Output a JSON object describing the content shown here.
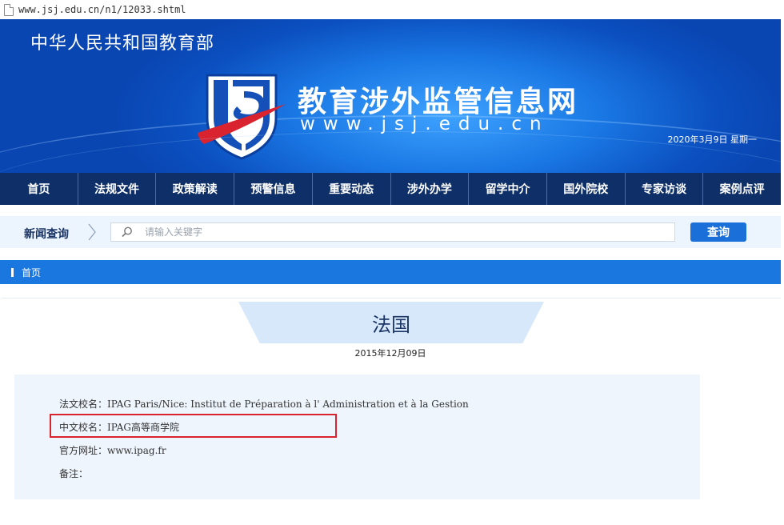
{
  "browser": {
    "url": "www.jsj.edu.cn/n1/12033.shtml"
  },
  "header": {
    "ministry": "中华人民共和国教育部",
    "site_title": "教育涉外监管信息网",
    "site_url": "www.jsj.edu.cn",
    "date": "2020年3月9日  星期一",
    "colors": {
      "banner_blue": "#1a78e4",
      "nav_navy": "#0e2f68",
      "logo_red": "#d9232e"
    }
  },
  "nav": {
    "items": [
      {
        "label": "首页"
      },
      {
        "label": "法规文件"
      },
      {
        "label": "政策解读"
      },
      {
        "label": "预警信息"
      },
      {
        "label": "重要动态"
      },
      {
        "label": "涉外办学"
      },
      {
        "label": "留学中介"
      },
      {
        "label": "国外院校"
      },
      {
        "label": "专家访谈"
      },
      {
        "label": "案例点评"
      }
    ]
  },
  "search": {
    "label": "新闻查询",
    "placeholder": "请输入关键字",
    "button": "查询",
    "icon": "search-icon"
  },
  "breadcrumb": {
    "home": "首页"
  },
  "article": {
    "title": "法国",
    "date": "2015年12月09日",
    "fields": [
      {
        "label": "法文校名：",
        "value": "IPAG Paris/Nice: Institut de Préparation à l' Administration et à la Gestion"
      },
      {
        "label": "中文校名：",
        "value": "IPAG高等商学院"
      },
      {
        "label": "官方网址：",
        "value": "www.ipag.fr"
      },
      {
        "label": "备注：",
        "value": ""
      }
    ],
    "highlight_color": "#d9232e"
  }
}
